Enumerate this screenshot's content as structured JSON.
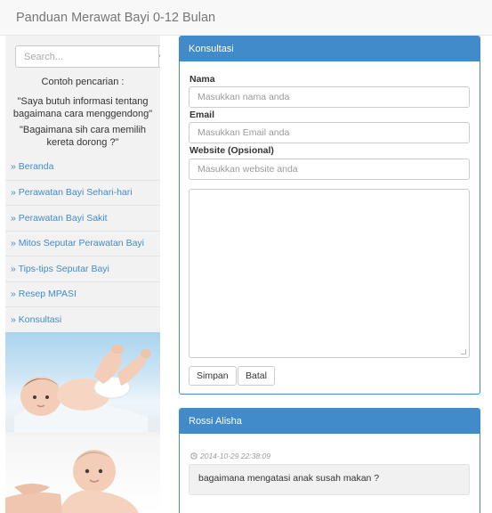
{
  "navbar": {
    "brand": "Panduan Merawat Bayi 0-12 Bulan"
  },
  "sidebar": {
    "search_placeholder": "Search...",
    "search_icon": "search-icon",
    "example_title": "Contoh pencarian :",
    "example_1": "\"Saya butuh informasi tentang bagaimana cara menggendong\"",
    "example_2": "\"Bagaimana sih cara memilih kereta dorong ?\"",
    "menu": [
      "» Beranda",
      "» Perawatan Bayi Sehari-hari",
      "» Perawatan Bayi Sakit",
      "» Mitos Seputar Perawatan Bayi",
      "» Tips-tips Seputar Bayi",
      "» Resep MPASI",
      "» Konsultasi"
    ],
    "link_color": "#428bca"
  },
  "form": {
    "heading": "Konsultasi",
    "name_label": "Nama",
    "name_placeholder": "Masukkan nama anda",
    "email_label": "Email",
    "email_placeholder": "Masukkan Email anda",
    "website_label": "Website (Opsional)",
    "website_placeholder": "Masukkan website anda",
    "save_label": "Simpan",
    "cancel_label": "Batal"
  },
  "comment": {
    "heading": "Rossi Alisha",
    "timestamp": "2014-10-29 22:38:09",
    "clock_icon": "clock-icon",
    "message": "bagaimana mengatasi anak susah makan ?"
  },
  "colors": {
    "primary": "#428bca",
    "sidebar_bg": "#f2f2f2",
    "navbar_bg": "#f8f8f8"
  }
}
